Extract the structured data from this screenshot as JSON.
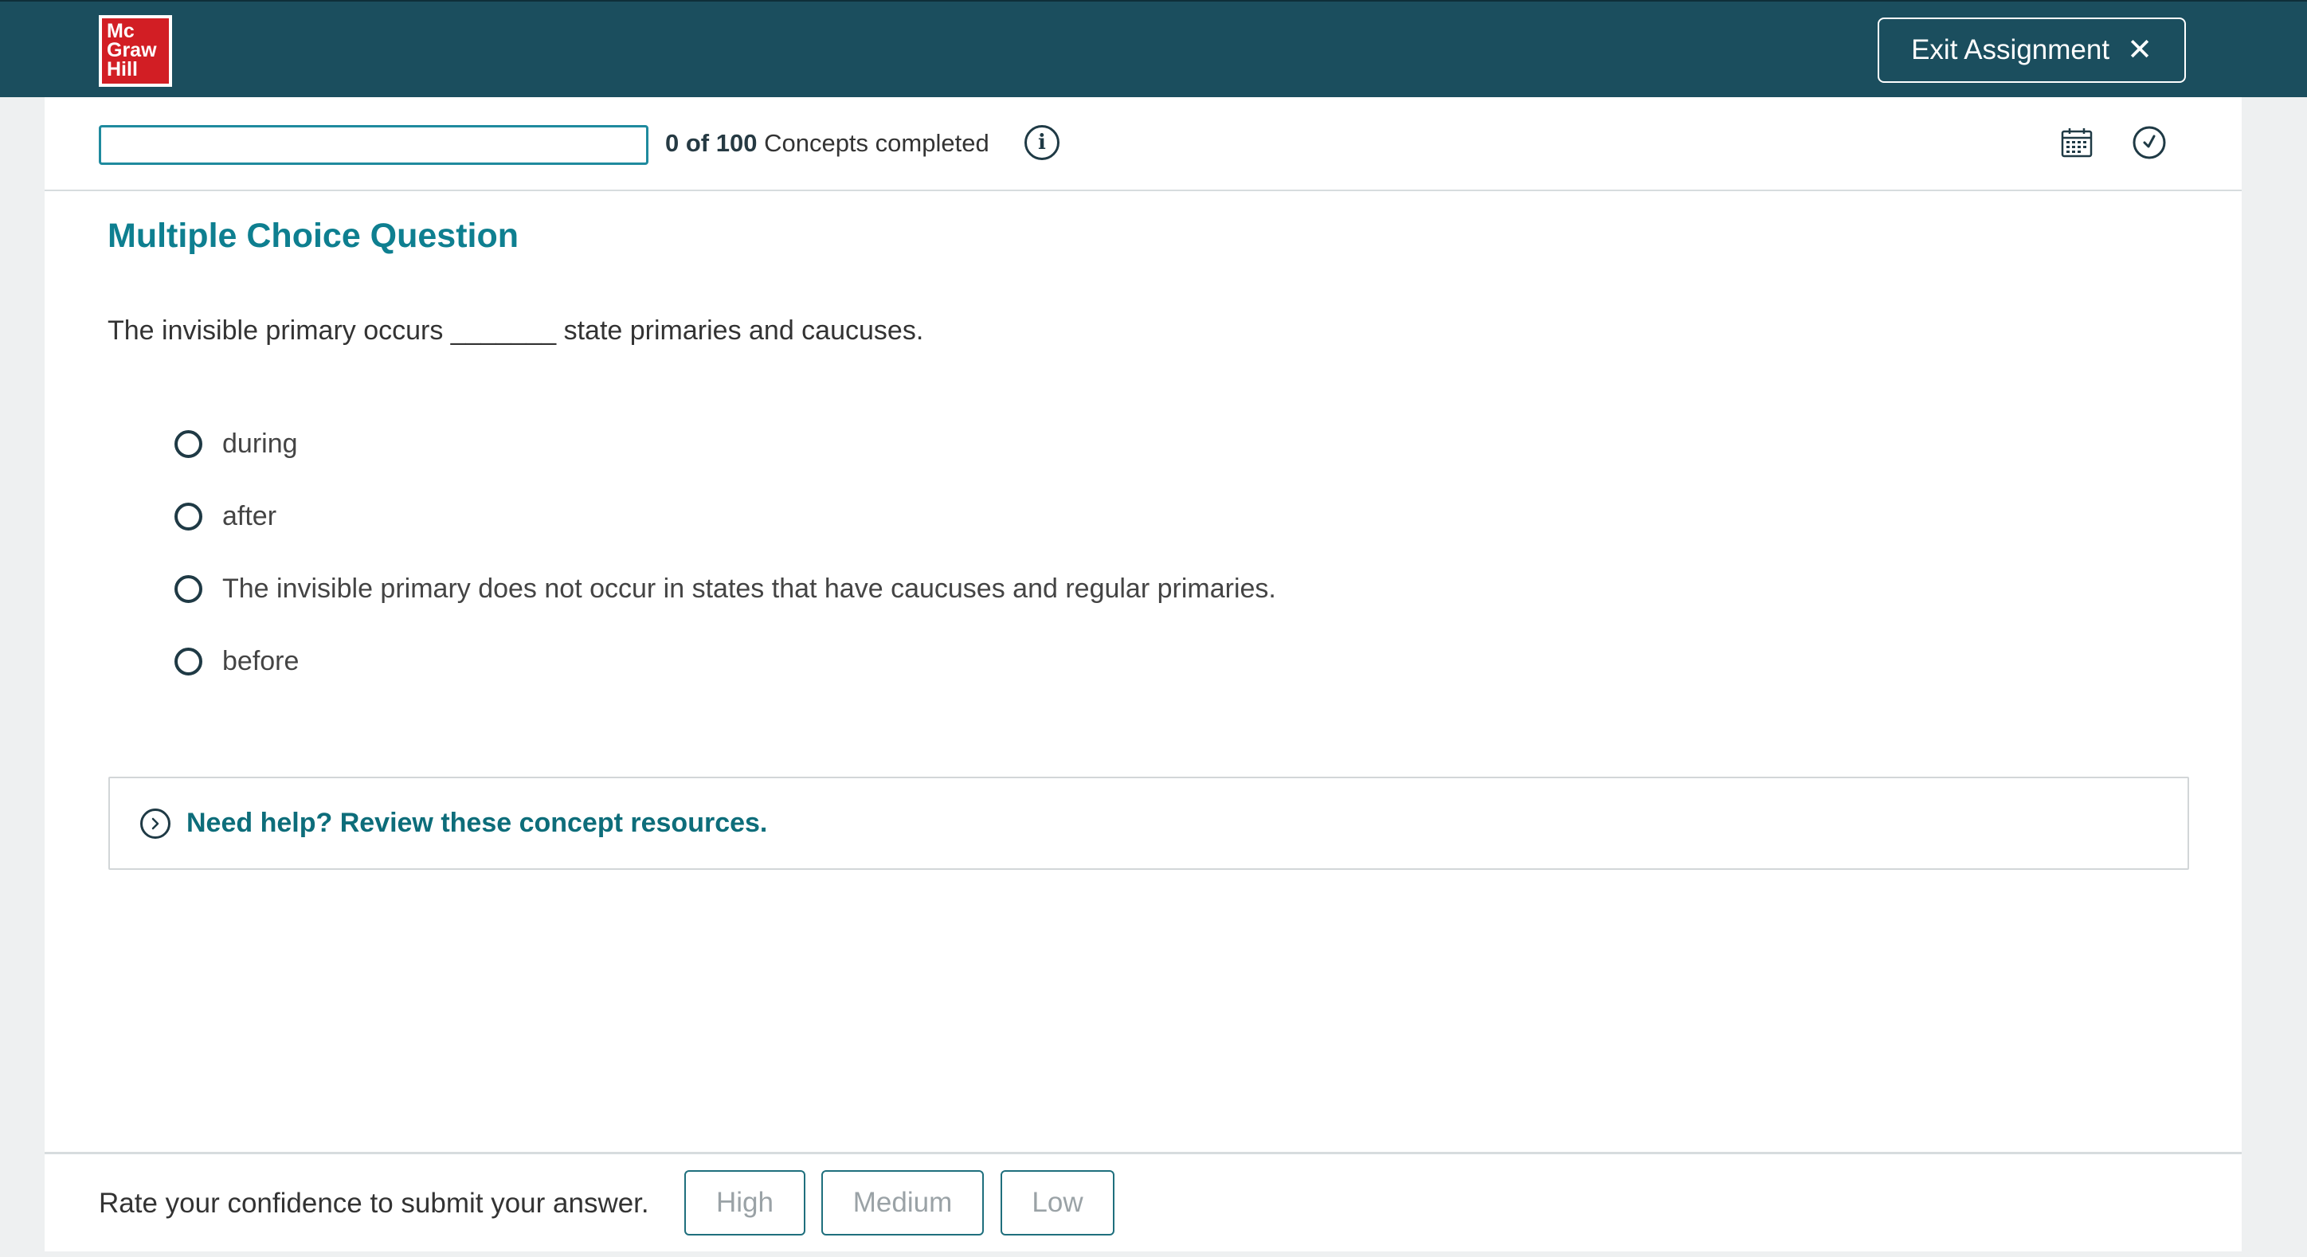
{
  "header": {
    "logo_lines": [
      "Mc",
      "Graw",
      "Hill"
    ],
    "exit_label": "Exit Assignment",
    "exit_icon": "close-icon"
  },
  "progress": {
    "completed": "0 of 100",
    "label": "Concepts completed",
    "fraction": 0.0,
    "icons": [
      "info-icon",
      "calendar-icon",
      "clock-icon"
    ]
  },
  "question": {
    "title": "Multiple Choice Question",
    "text": "The invisible primary occurs _______ state primaries and caucuses.",
    "options": [
      "during",
      "after",
      "The invisible primary does not occur in states that have caucuses and regular primaries.",
      "before"
    ]
  },
  "help": {
    "label": "Need help? Review these concept resources."
  },
  "confidence": {
    "prompt": "Rate your confidence to submit your answer.",
    "high": "High",
    "medium": "Medium",
    "low": "Low"
  },
  "colors": {
    "header_bg": "#1b4e5e",
    "accent": "#0e7f90",
    "logo_red": "#d21e24"
  }
}
